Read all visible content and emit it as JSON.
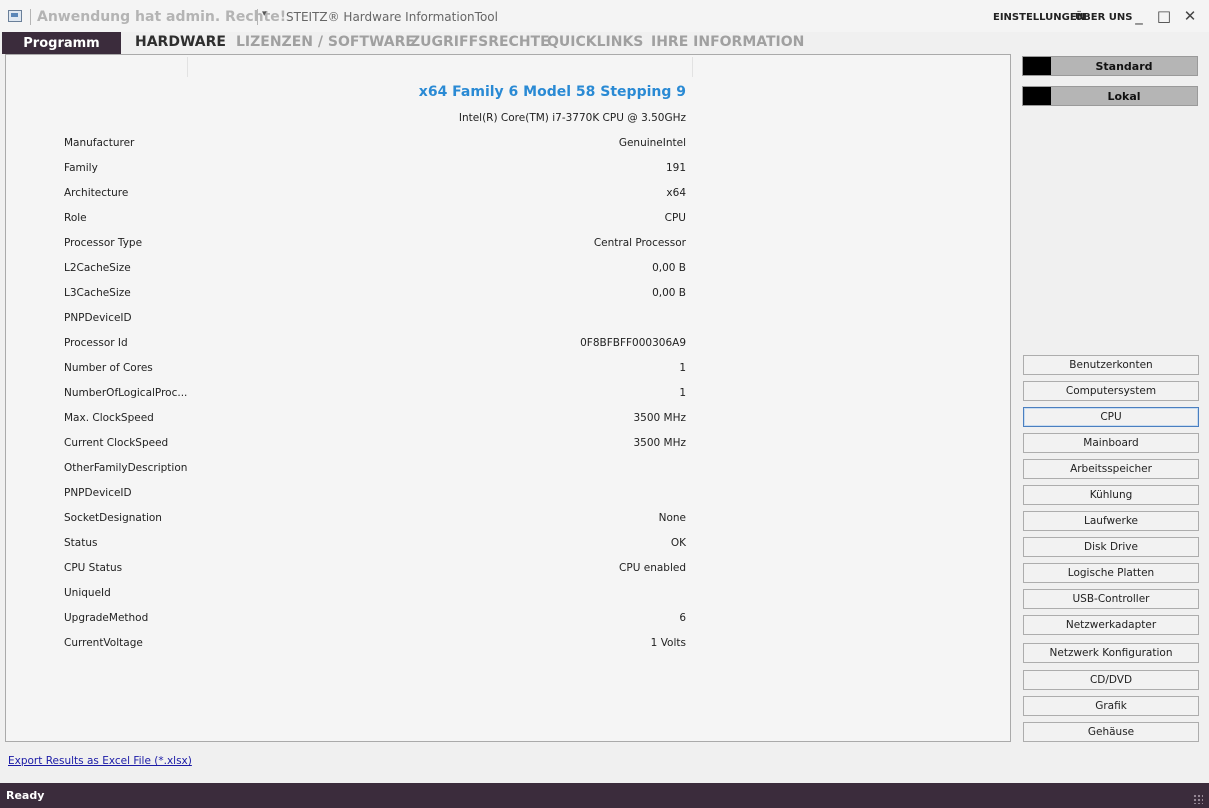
{
  "titlebar": {
    "admin_label": "Anwendung hat admin. Rechte!",
    "qa_arrow": "▾",
    "app_title": "STEITZ® Hardware InformationTool",
    "links": [
      "EINSTELLUNGEN",
      "ÜBER UNS"
    ],
    "window_controls": {
      "minimize": "_",
      "maximize": "□",
      "close": "✕"
    }
  },
  "menu": {
    "programm": "Programm",
    "tabs": [
      "HARDWARE",
      "LIZENZEN / SOFTWARE",
      "ZUGRIFFSRECHTE",
      "QUICKLINKS",
      "IHRE INFORMATION"
    ],
    "active_tab": "HARDWARE"
  },
  "cpu": {
    "title": "x64 Family 6 Model 58 Stepping 9",
    "subtitle": "Intel(R) Core(TM) i7-3770K CPU @ 3.50GHz",
    "properties": [
      {
        "label": "Manufacturer",
        "value": "GenuineIntel"
      },
      {
        "label": "Family",
        "value": "191"
      },
      {
        "label": "Architecture",
        "value": "x64"
      },
      {
        "label": "Role",
        "value": "CPU"
      },
      {
        "label": "Processor Type",
        "value": "Central Processor"
      },
      {
        "label": "L2CacheSize",
        "value": "0,00 B"
      },
      {
        "label": "L3CacheSize",
        "value": "0,00 B"
      },
      {
        "label": "PNPDeviceID",
        "value": ""
      },
      {
        "label": "Processor Id",
        "value": "0F8BFBFF000306A9"
      },
      {
        "label": "Number of Cores",
        "value": "1"
      },
      {
        "label": "NumberOfLogicalProc...",
        "value": "1"
      },
      {
        "label": "Max. ClockSpeed",
        "value": "3500 MHz"
      },
      {
        "label": "Current ClockSpeed",
        "value": "3500 MHz"
      },
      {
        "label": "OtherFamilyDescription",
        "value": ""
      },
      {
        "label": "PNPDeviceID",
        "value": ""
      },
      {
        "label": "SocketDesignation",
        "value": "None"
      },
      {
        "label": "Status",
        "value": "OK"
      },
      {
        "label": "CPU Status",
        "value": "CPU enabled"
      },
      {
        "label": "UniqueId",
        "value": ""
      },
      {
        "label": "UpgradeMethod",
        "value": "6"
      },
      {
        "label": "CurrentVoltage",
        "value": "1 Volts"
      }
    ]
  },
  "sidebar": {
    "view_buttons": [
      "Standard",
      "Lokal"
    ],
    "categories": [
      "Benutzerkonten",
      "Computersystem",
      "CPU",
      "Mainboard",
      "Arbeitsspeicher",
      "Kühlung",
      "Laufwerke",
      "Disk Drive",
      "Logische Platten",
      "USB-Controller",
      "Netzwerkadapter",
      "Netzwerk Konfiguration",
      "CD/DVD",
      "Grafik",
      "Gehäuse"
    ],
    "selected": "CPU"
  },
  "footer": {
    "export_link": "Export Results as Excel File (*.xlsx)"
  },
  "statusbar": {
    "text": "Ready"
  },
  "colors": {
    "accent_dark": "#3b2c3c",
    "title_blue": "#2a8ad4",
    "link_blue": "#1a1aa6"
  }
}
